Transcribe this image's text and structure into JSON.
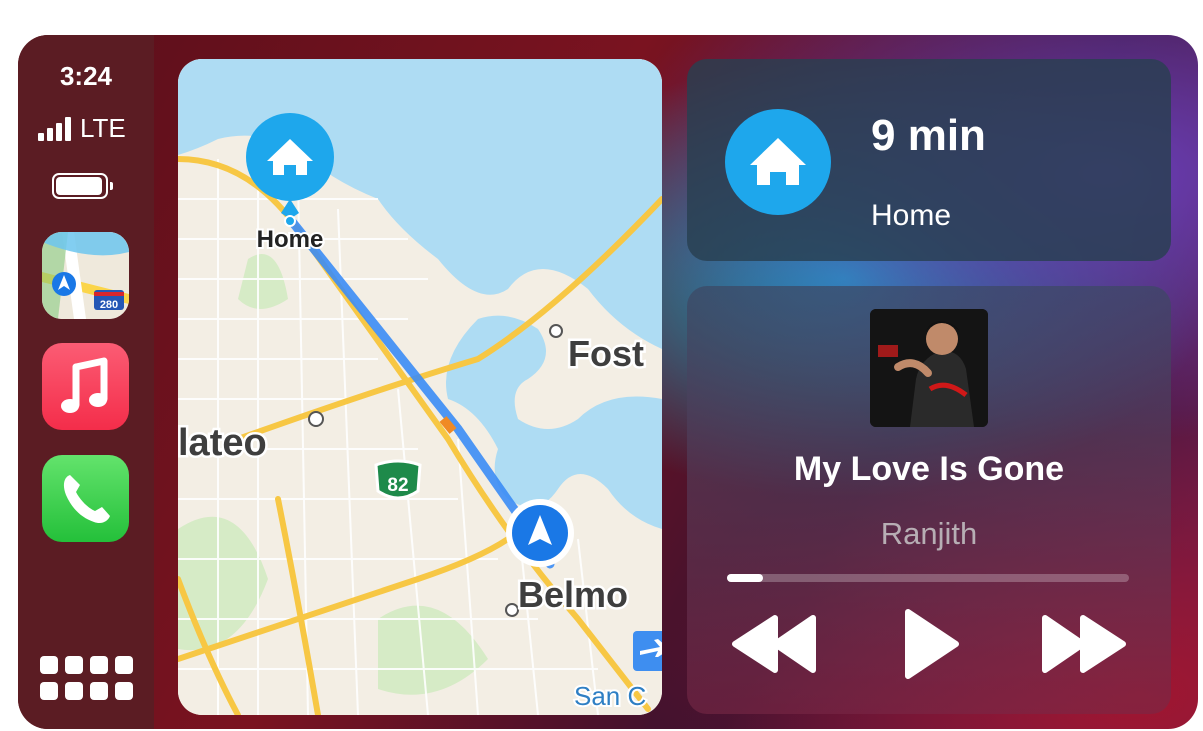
{
  "status": {
    "time": "3:24",
    "network": "LTE",
    "signal_bars": 4,
    "battery_level": 1.0
  },
  "dock": {
    "apps": [
      {
        "name": "Maps",
        "icon": "maps-icon"
      },
      {
        "name": "Music",
        "icon": "music-icon"
      },
      {
        "name": "Phone",
        "icon": "phone-icon"
      }
    ],
    "launcher_icon": "app-grid-icon"
  },
  "map": {
    "labels": {
      "home": "Home",
      "foster": "Fost",
      "mateo": "lateo",
      "belmont": "Belmo",
      "san_carlos": "San C",
      "route_82": "82",
      "route_280": "280"
    },
    "route_color": "#2f86f6",
    "water_color": "#a9d9f2"
  },
  "navigation": {
    "eta": "9 min",
    "destination": "Home",
    "icon": "home-icon",
    "accent": "#1ea7ec"
  },
  "now_playing": {
    "title": "My Love Is Gone",
    "artist": "Ranjith",
    "progress": 0.09,
    "controls": [
      "previous",
      "play",
      "next"
    ]
  }
}
